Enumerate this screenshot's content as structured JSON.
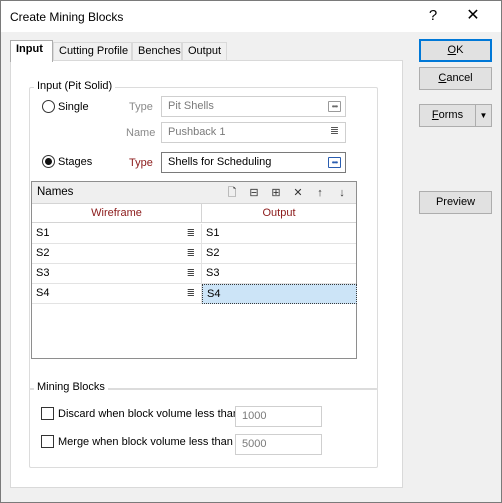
{
  "window": {
    "title": "Create Mining Blocks",
    "help_glyph": "?",
    "close_glyph": "✕"
  },
  "tabs": [
    {
      "label": "Input",
      "active": true
    },
    {
      "label": "Cutting Profile",
      "active": false
    },
    {
      "label": "Benches",
      "active": false
    },
    {
      "label": "Output",
      "active": false
    }
  ],
  "input_group": {
    "legend": "Input (Pit Solid)",
    "single": {
      "label": "Single",
      "checked": false,
      "type_label": "Type",
      "type_value": "Pit Shells",
      "name_label": "Name",
      "name_value": "Pushback 1"
    },
    "stages": {
      "label": "Stages",
      "checked": true,
      "type_label": "Type",
      "type_value": "Shells for Scheduling"
    },
    "names_grid": {
      "title": "Names",
      "columns": [
        "Wireframe",
        "Output"
      ],
      "rows": [
        {
          "wireframe": "S1",
          "output": "S1"
        },
        {
          "wireframe": "S2",
          "output": "S2"
        },
        {
          "wireframe": "S3",
          "output": "S3"
        },
        {
          "wireframe": "S4",
          "output": "S4"
        }
      ],
      "toolbar_icons": [
        "new-row-icon",
        "insert-row-icon",
        "append-row-icon",
        "delete-row-icon",
        "move-up-icon",
        "move-down-icon"
      ]
    }
  },
  "mining_blocks": {
    "legend": "Mining Blocks",
    "discard": {
      "label": "Discard when block volume less than",
      "checked": false,
      "value": "1000"
    },
    "merge": {
      "label": "Merge when block volume less than",
      "checked": false,
      "value": "5000"
    }
  },
  "buttons": {
    "ok": {
      "accel": "O",
      "rest": "K"
    },
    "cancel": {
      "accel": "C",
      "rest": "ancel"
    },
    "forms": {
      "accel": "F",
      "rest": "orms"
    },
    "preview": "Preview"
  },
  "colors": {
    "accent": "#0078d7",
    "required_label": "#8b1a1a",
    "selected_cell": "#cce4f7"
  }
}
